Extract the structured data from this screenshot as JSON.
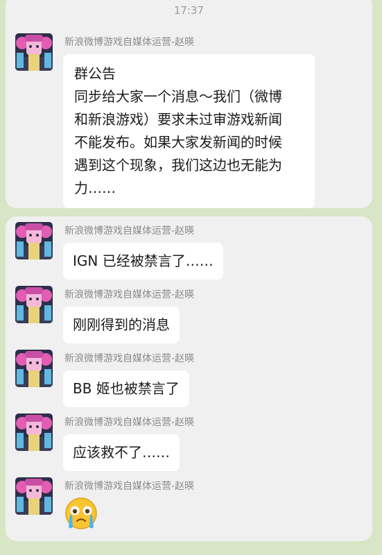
{
  "chat": {
    "timestamp": "17:37",
    "sender_name": "新浪微博游戏自媒体运营-赵暎",
    "announcement": {
      "lines": [
        "群公告",
        "同步给大家一个消息～我们（微博",
        "和新浪游戏）要求未过审游戏新闻",
        "不能发布。如果大家发新闻的时候",
        "遇到这个现象，我们这边也无能为",
        "力……"
      ]
    },
    "messages": [
      {
        "text": "IGN 已经被禁言了……"
      },
      {
        "text": "刚刚得到的消息"
      },
      {
        "text": "BB 姬也被禁言了"
      },
      {
        "text": "应该救不了……"
      },
      {
        "emoji": "crying-face"
      }
    ]
  }
}
